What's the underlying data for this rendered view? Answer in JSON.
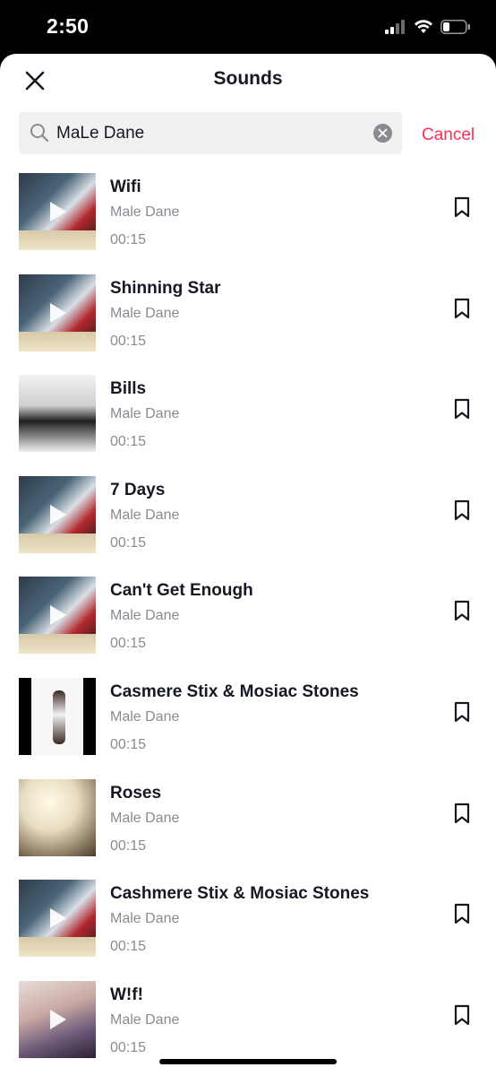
{
  "status_bar": {
    "time": "2:50"
  },
  "header": {
    "title": "Sounds"
  },
  "search": {
    "value": "MaLe Dane",
    "cancel_label": "Cancel"
  },
  "results": [
    {
      "title": "Wifi",
      "artist": "Male Dane",
      "duration": "00:15",
      "cover": "art-a",
      "has_play": true
    },
    {
      "title": "Shinning Star",
      "artist": "Male Dane",
      "duration": "00:15",
      "cover": "art-a",
      "has_play": true
    },
    {
      "title": "Bills",
      "artist": "Male Dane",
      "duration": "00:15",
      "cover": "art-b",
      "has_play": false
    },
    {
      "title": "7 Days",
      "artist": "Male Dane",
      "duration": "00:15",
      "cover": "art-a",
      "has_play": true
    },
    {
      "title": "Can't Get Enough",
      "artist": "Male Dane",
      "duration": "00:15",
      "cover": "art-a",
      "has_play": true
    },
    {
      "title": "Casmere Stix & Mosiac Stones",
      "artist": "Male Dane",
      "duration": "00:15",
      "cover": "art-c",
      "has_play": false
    },
    {
      "title": "Roses",
      "artist": "Male Dane",
      "duration": "00:15",
      "cover": "art-d",
      "has_play": false
    },
    {
      "title": "Cashmere Stix & Mosiac Stones",
      "artist": "Male Dane",
      "duration": "00:15",
      "cover": "art-a",
      "has_play": true
    },
    {
      "title": "W!f!",
      "artist": "Male Dane",
      "duration": "00:15",
      "cover": "art-e",
      "has_play": true
    }
  ],
  "colors": {
    "accent": "#fe2c55",
    "text_primary": "#161823",
    "text_secondary": "#8a8b91"
  },
  "icons": {
    "close": "close-icon",
    "search": "search-icon",
    "clear": "clear-icon",
    "bookmark": "bookmark-icon",
    "play": "play-icon"
  }
}
